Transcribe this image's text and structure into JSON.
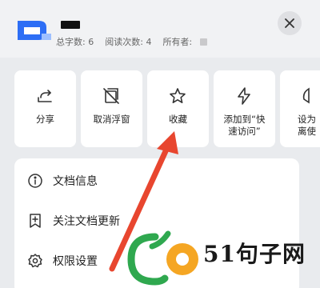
{
  "header": {
    "meta": {
      "word_count_label": "总字数:",
      "word_count_value": "6",
      "read_count_label": "阅读次数:",
      "read_count_value": "4",
      "owner_label": "所有者:"
    },
    "close_icon": "close-icon"
  },
  "actions": [
    {
      "icon": "share-icon",
      "label": "分享"
    },
    {
      "icon": "cancel-float-window-icon",
      "label": "取消浮窗"
    },
    {
      "icon": "star-icon",
      "label": "收藏"
    },
    {
      "icon": "lightning-icon",
      "label": "添加到“快速访问”"
    },
    {
      "icon": "set-as-icon",
      "label": "设为离使"
    }
  ],
  "menu": [
    {
      "icon": "info-icon",
      "label": "文档信息"
    },
    {
      "icon": "follow-update-icon",
      "label": "关注文档更新"
    },
    {
      "icon": "settings-gear-icon",
      "label": "权限设置"
    }
  ],
  "watermark": {
    "text": "51句子网"
  },
  "colors": {
    "arrow": "#e8462f",
    "watermark_green": "#2fa84f",
    "watermark_orange": "#f5a623"
  }
}
